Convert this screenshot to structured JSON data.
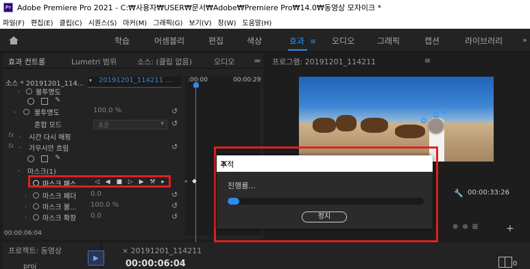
{
  "window": {
    "title": "Adobe Premiere Pro 2021 - C:₩사용자₩USER₩문서₩Adobe₩Premiere Pro₩14.0₩동영상 모자이크 *",
    "app_icon": "Pr"
  },
  "menu": [
    "파일(F)",
    "편집(E)",
    "클립(C)",
    "시퀀스(S)",
    "마커(M)",
    "그래픽(G)",
    "보기(V)",
    "창(W)",
    "도움말(H)"
  ],
  "workspaces": {
    "tabs": [
      "학습",
      "어셈블리",
      "편집",
      "색상",
      "효과",
      "오디오",
      "그래픽",
      "캡션",
      "라이브러리"
    ],
    "active": "효과",
    "more": "»"
  },
  "effect_panel": {
    "tabs": [
      "효과 컨트롤",
      "Lumetri 범위",
      "소스: (클립 없음)",
      "오디오"
    ],
    "more_tabs": "»",
    "source_label": "소스 * 20191201_114...",
    "clip_label": "20191201_114211 ...",
    "time_start": ":00:00",
    "time_end": "00:00:29",
    "rows": {
      "opacity_prev": "불투명도",
      "opacity_label": "불투명도",
      "opacity_value": "100.0 %",
      "blend_label": "혼합 모드",
      "blend_value": "표준",
      "time_remap": "시간 다시 매핑",
      "gaussian_blur": "가우시안 흐림",
      "mask": "마스크(1)",
      "mask_path": "마스크 패스",
      "mask_path_controls": "◁ ◀ ■ ▷ ▶ ⚒ ▸",
      "mask_feather": "마스크 페더",
      "mask_feather_value": "0.0",
      "mask_opacity": "마스크 불...",
      "mask_opacity_value": "100.0 %",
      "mask_expand": "마스크 확장",
      "mask_expand_value": "0.0"
    },
    "bottom_time": "00:00:06:04"
  },
  "program_monitor": {
    "tab": "프로그램: 20191201_114211",
    "more": "≡",
    "timecode": "00:00:33:26"
  },
  "project_panel": {
    "tab": "프로젝트: 동영상",
    "item": "proj"
  },
  "timeline_panel": {
    "tab": "20191201_114211",
    "timecode": "00:00:06:04",
    "corner_num": "0"
  },
  "dialog": {
    "title": "추적",
    "progress_label": "진행률...",
    "progress_fraction": 0.06,
    "stop_button": "정지"
  },
  "colors": {
    "accent": "#2d8ceb",
    "highlight": "#e02020"
  }
}
